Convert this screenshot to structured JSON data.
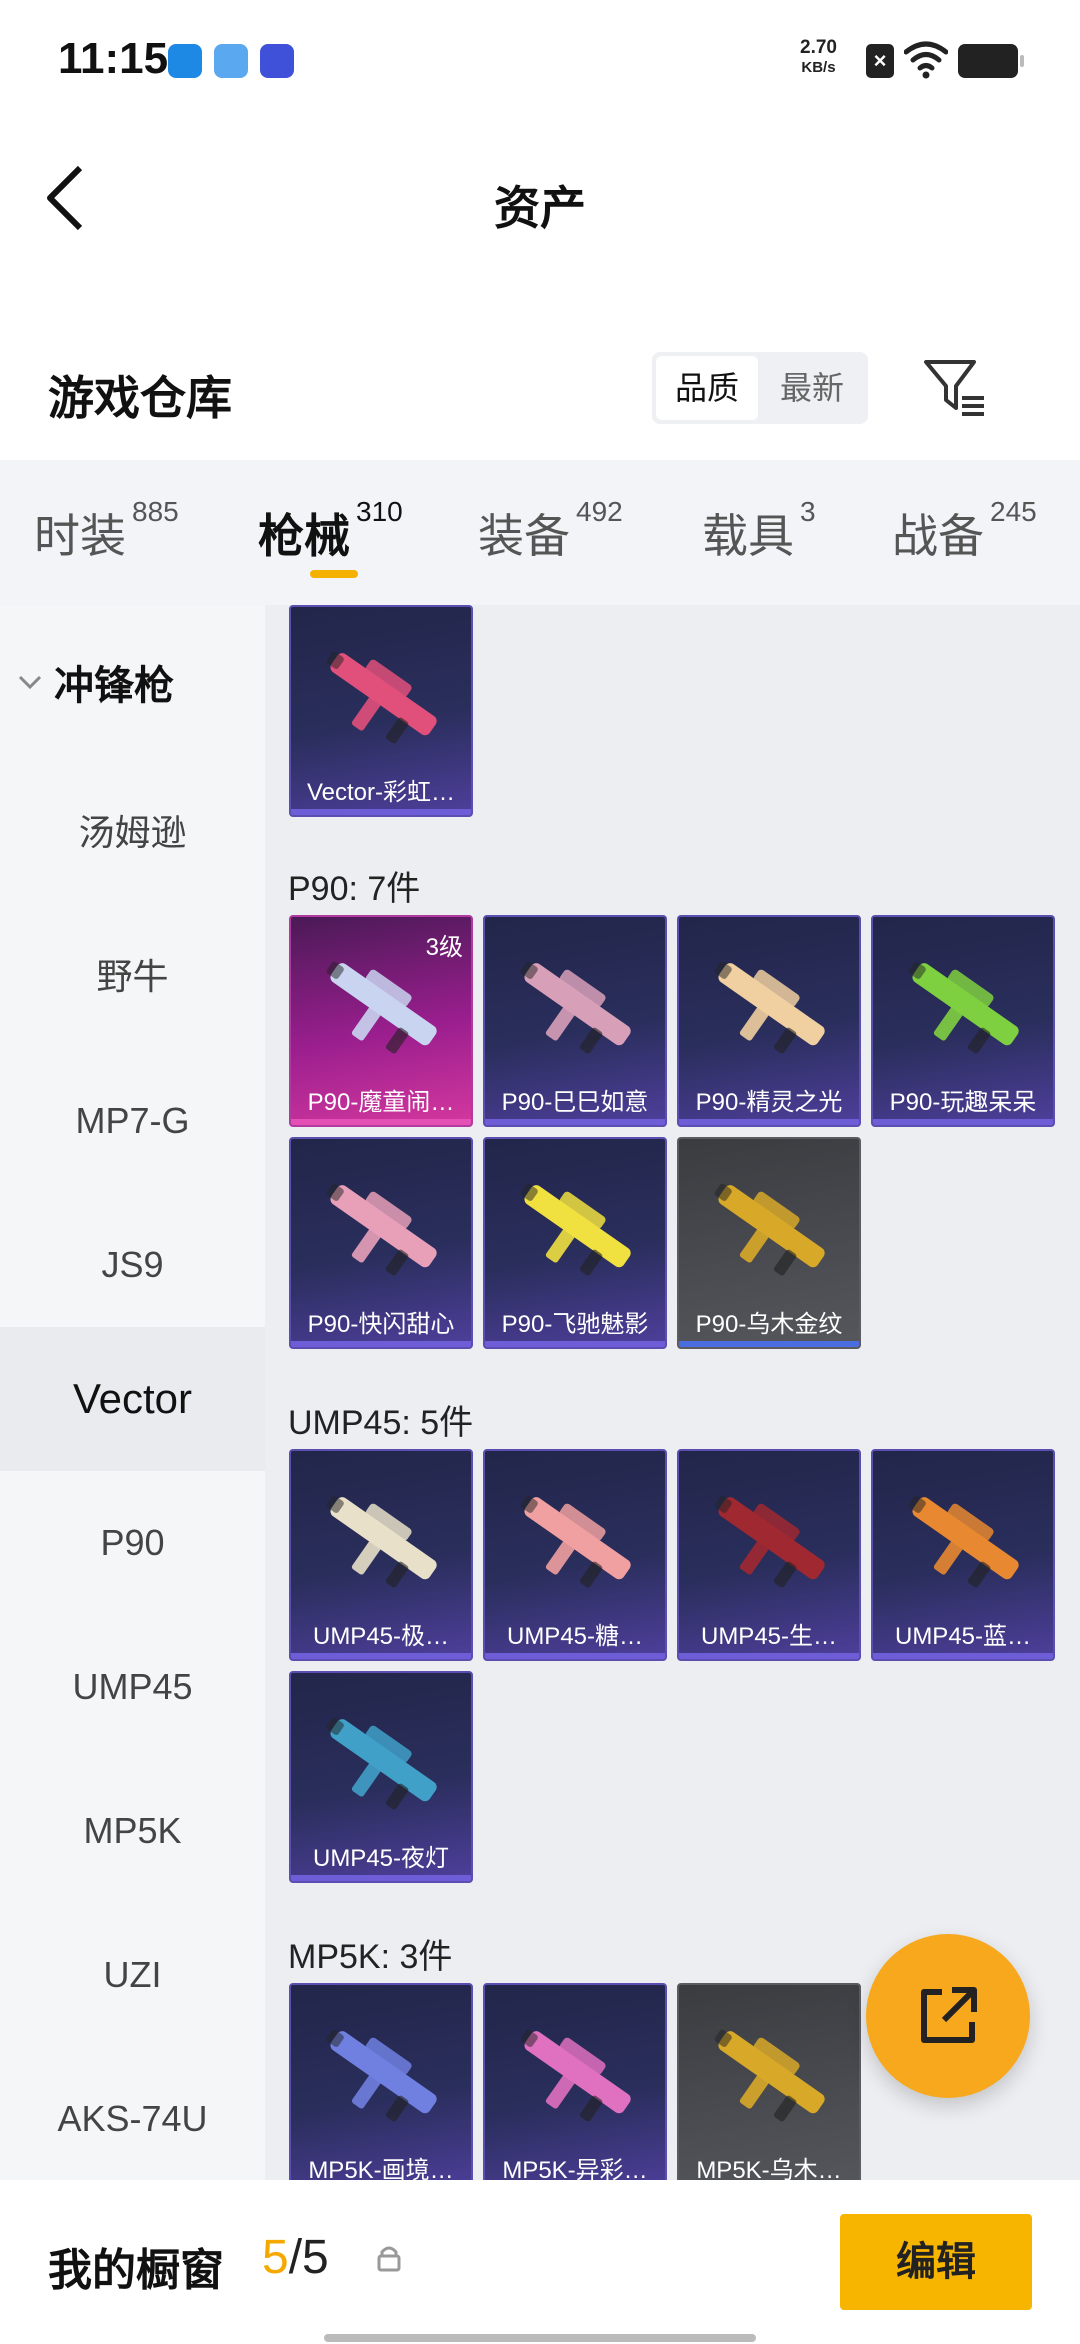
{
  "status": {
    "time": "11:15",
    "speed_value": "2.70",
    "speed_unit": "KB/s"
  },
  "header": {
    "title": "资产"
  },
  "section": {
    "title": "游戏仓库",
    "sort_options": [
      "品质",
      "最新"
    ]
  },
  "tabs": [
    {
      "label": "时装",
      "count": "885"
    },
    {
      "label": "枪械",
      "count": "310"
    },
    {
      "label": "装备",
      "count": "492"
    },
    {
      "label": "载具",
      "count": "3"
    },
    {
      "label": "战备",
      "count": "245"
    }
  ],
  "sidebar": {
    "group": "冲锋枪",
    "items": [
      "汤姆逊",
      "野牛",
      "MP7-G",
      "JS9",
      "Vector",
      "P90",
      "UMP45",
      "MP5K",
      "UZI",
      "AKS-74U"
    ]
  },
  "grid": {
    "top_card": {
      "name": "Vector-彩虹…",
      "color": "#e0507a"
    },
    "sections": [
      {
        "label": "P90: 7件",
        "cards": [
          {
            "name": "P90-魔童闹…",
            "level": "3级",
            "style": "pink",
            "color": "#c9d4f0"
          },
          {
            "name": "P90-巳巳如意",
            "style": "purple",
            "color": "#d8a0b8"
          },
          {
            "name": "P90-精灵之光",
            "style": "purple",
            "color": "#f0cfa0"
          },
          {
            "name": "P90-玩趣呆呆",
            "style": "purple",
            "color": "#7fd040"
          },
          {
            "name": "P90-快闪甜心",
            "style": "purple",
            "color": "#e8a0b8"
          },
          {
            "name": "P90-飞驰魅影",
            "style": "purple",
            "color": "#f0e040"
          },
          {
            "name": "P90-乌木金纹",
            "style": "gray",
            "color": "#d8a828"
          }
        ]
      },
      {
        "label": "UMP45: 5件",
        "cards": [
          {
            "name": "UMP45-极…",
            "style": "purple",
            "color": "#e8e0c8"
          },
          {
            "name": "UMP45-糖…",
            "style": "purple",
            "color": "#f0a0a0"
          },
          {
            "name": "UMP45-生…",
            "style": "purple",
            "color": "#a02830"
          },
          {
            "name": "UMP45-蓝…",
            "style": "purple",
            "color": "#e88830"
          },
          {
            "name": "UMP45-夜灯",
            "style": "purple",
            "color": "#40a0c8"
          }
        ]
      },
      {
        "label": "MP5K: 3件",
        "cards": [
          {
            "name": "MP5K-画境…",
            "style": "purple",
            "color": "#7080e0"
          },
          {
            "name": "MP5K-异彩…",
            "style": "purple",
            "color": "#e070c0"
          },
          {
            "name": "MP5K-乌木…",
            "style": "gray",
            "color": "#d8a828"
          }
        ]
      }
    ]
  },
  "bottom": {
    "label": "我的橱窗",
    "count_current": "5",
    "count_sep": "/",
    "count_total": "5",
    "edit_label": "编辑"
  },
  "colors": {
    "accent": "#f5b100",
    "fab": "#f7a81c"
  }
}
